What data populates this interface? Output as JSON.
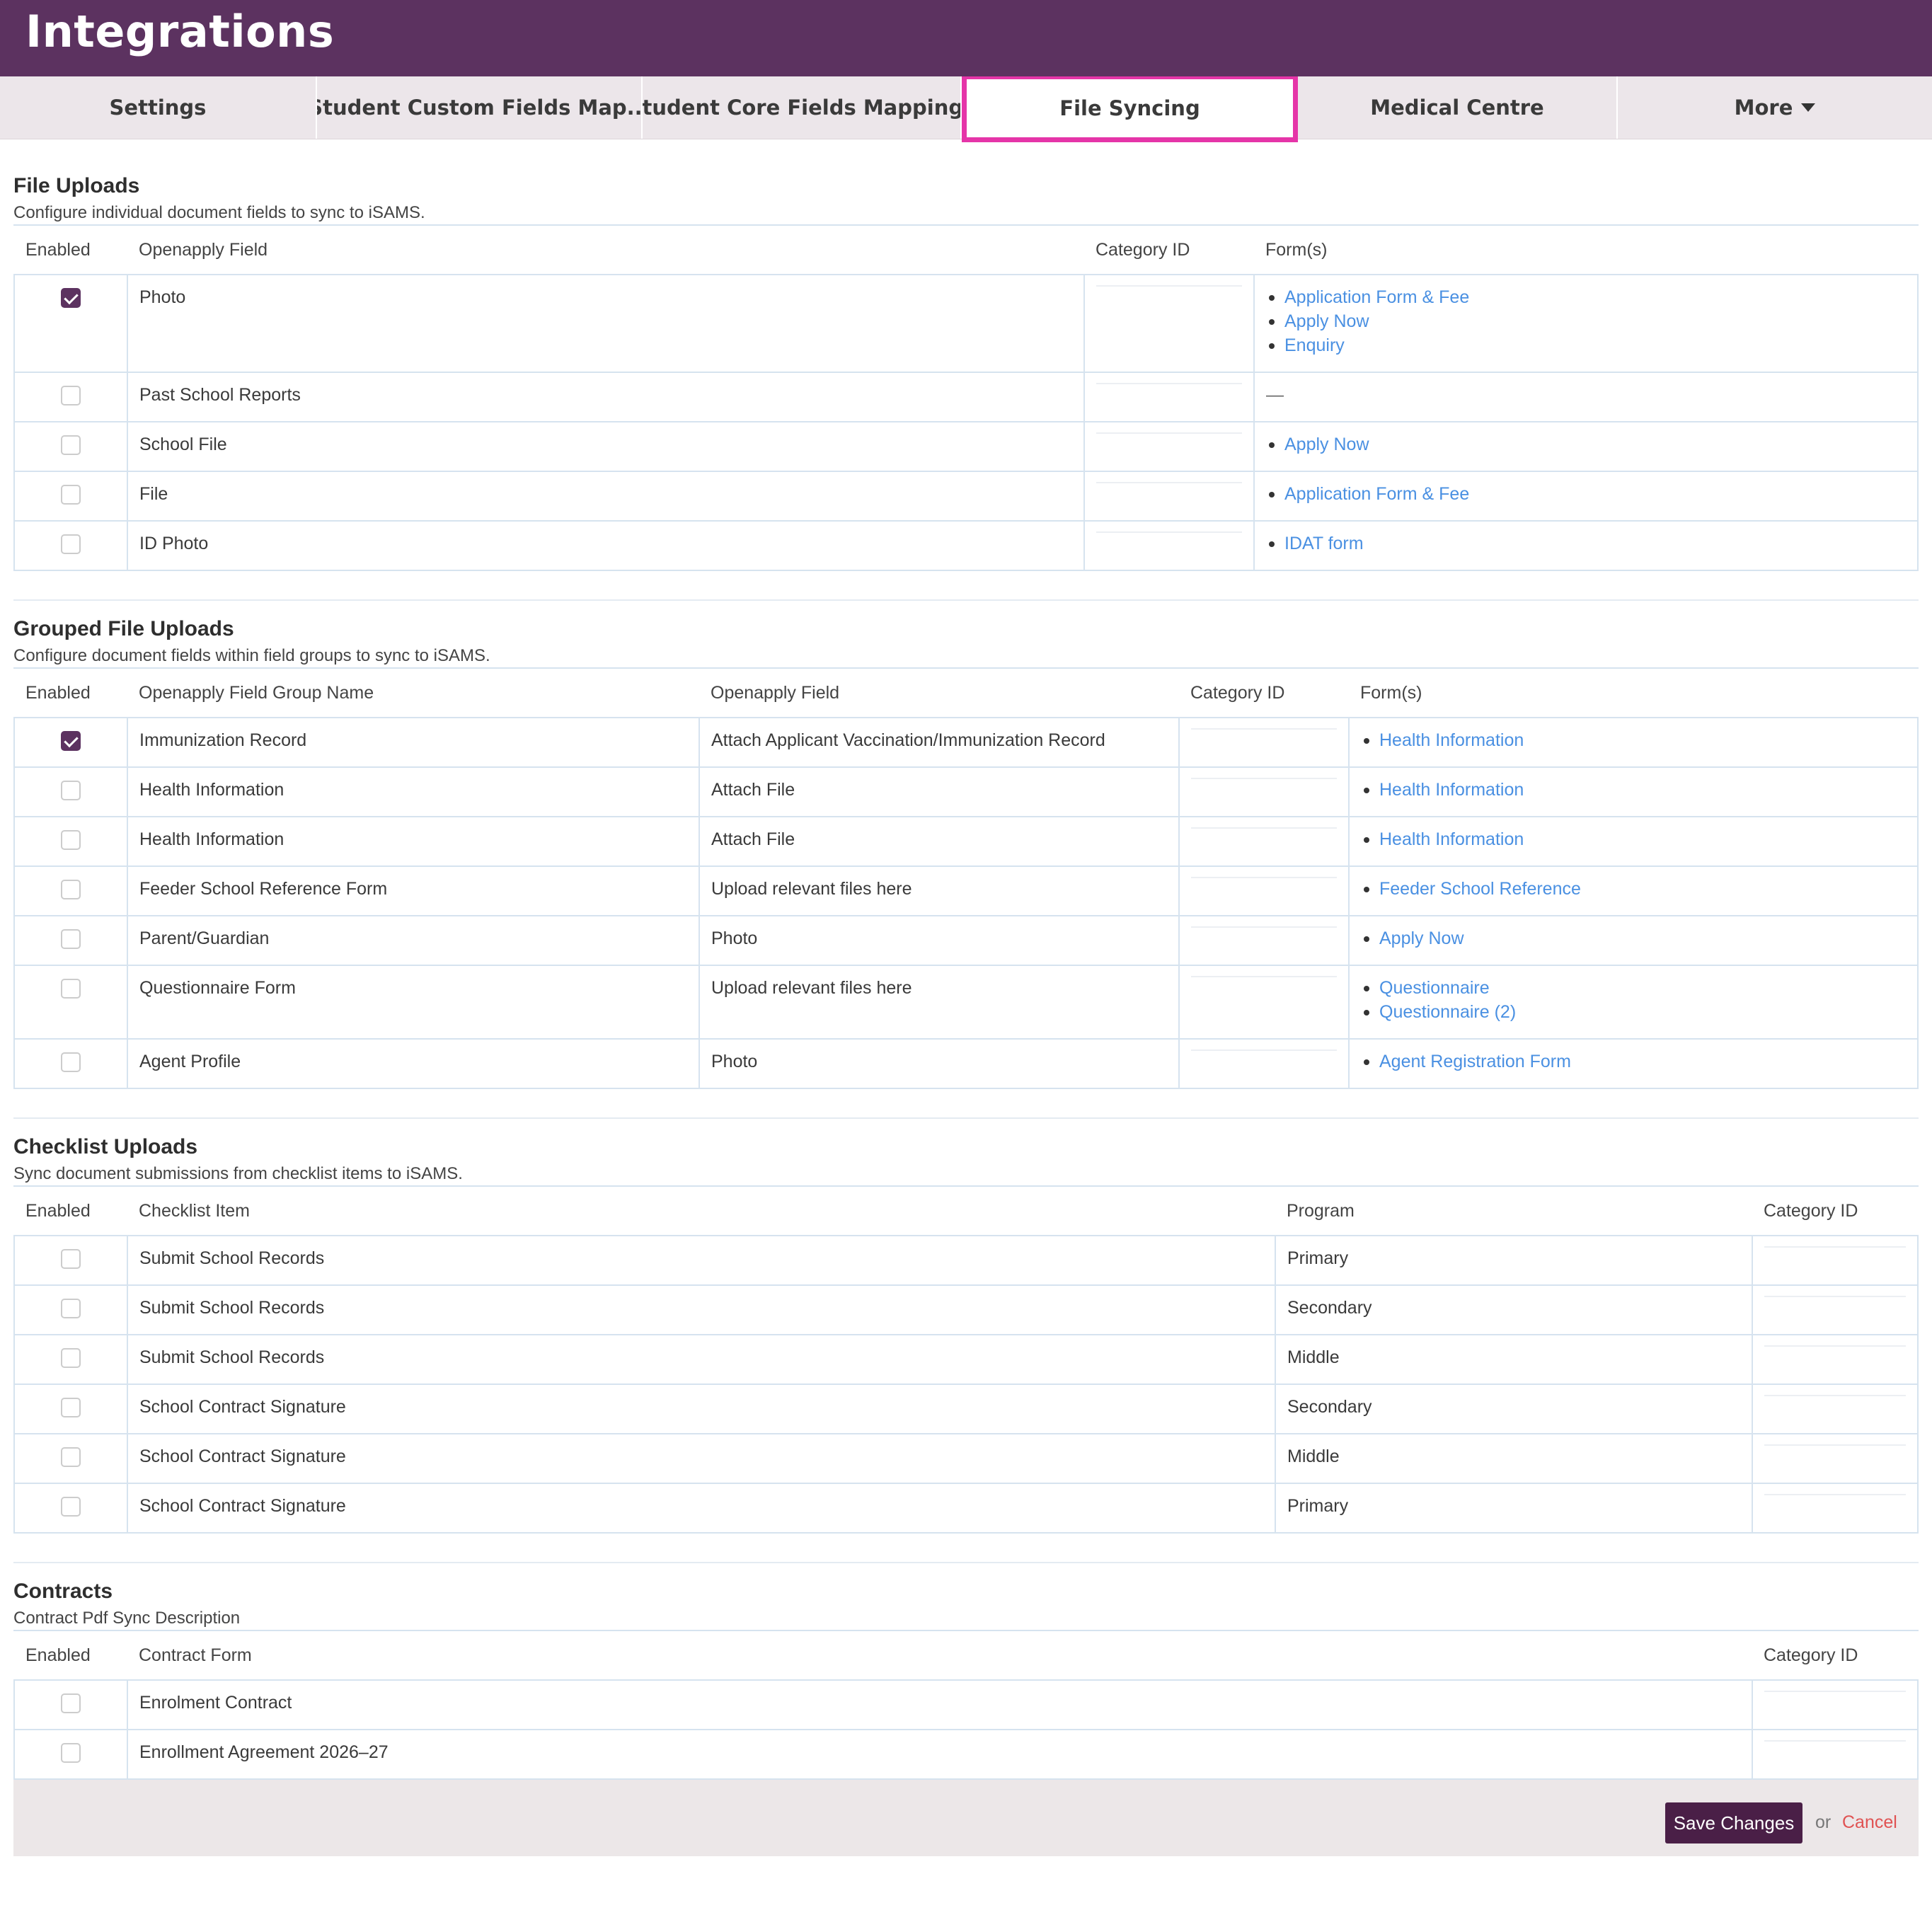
{
  "header": {
    "title": "Integrations"
  },
  "tabs": [
    {
      "label": "Settings"
    },
    {
      "label": "Student Custom Fields Map..."
    },
    {
      "label": "Student Core Fields Mappings"
    },
    {
      "label": "File Syncing"
    },
    {
      "label": "Medical Centre"
    },
    {
      "label": "More"
    }
  ],
  "colors": {
    "brand": "#5c3260",
    "highlight": "#e535a8",
    "link": "#4a90e2",
    "cancel": "#e05252"
  },
  "file_uploads": {
    "title": "File Uploads",
    "description": "Configure individual document fields to sync to iSAMS.",
    "columns": [
      "Enabled",
      "Openapply Field",
      "Category ID",
      "Form(s)"
    ],
    "rows": [
      {
        "enabled": true,
        "field": "Photo",
        "forms": [
          "Application Form & Fee",
          "Apply Now",
          "Enquiry"
        ]
      },
      {
        "enabled": false,
        "field": "Past School Reports",
        "forms": [],
        "empty": "—"
      },
      {
        "enabled": false,
        "field": "School File",
        "forms": [
          "Apply Now"
        ]
      },
      {
        "enabled": false,
        "field": "File",
        "forms": [
          "Application Form & Fee"
        ]
      },
      {
        "enabled": false,
        "field": "ID Photo",
        "forms": [
          "IDAT form"
        ]
      }
    ]
  },
  "grouped_uploads": {
    "title": "Grouped File Uploads",
    "description": "Configure document fields within field groups to sync to iSAMS.",
    "columns": [
      "Enabled",
      "Openapply Field Group Name",
      "Openapply Field",
      "Category ID",
      "Form(s)"
    ],
    "rows": [
      {
        "enabled": true,
        "group": "Immunization Record",
        "field": "Attach Applicant Vaccination/Immunization Record",
        "forms": [
          "Health Information"
        ]
      },
      {
        "enabled": false,
        "group": "Health Information",
        "field": "Attach File",
        "forms": [
          "Health Information"
        ]
      },
      {
        "enabled": false,
        "group": "Health Information",
        "field": "Attach File",
        "forms": [
          "Health Information"
        ]
      },
      {
        "enabled": false,
        "group": "Feeder School Reference Form",
        "field": "Upload relevant files here",
        "forms": [
          "Feeder School Reference"
        ]
      },
      {
        "enabled": false,
        "group": "Parent/Guardian",
        "field": "Photo",
        "forms": [
          "Apply Now"
        ]
      },
      {
        "enabled": false,
        "group": "Questionnaire Form",
        "field": "Upload relevant files here",
        "forms": [
          "Questionnaire",
          "Questionnaire (2)"
        ]
      },
      {
        "enabled": false,
        "group": "Agent Profile",
        "field": "Photo",
        "forms": [
          "Agent Registration Form"
        ]
      }
    ]
  },
  "checklist_uploads": {
    "title": "Checklist Uploads",
    "description": "Sync document submissions from checklist items to iSAMS.",
    "columns": [
      "Enabled",
      "Checklist Item",
      "Program",
      "Category ID"
    ],
    "rows": [
      {
        "enabled": false,
        "item": "Submit School Records",
        "program": "Primary"
      },
      {
        "enabled": false,
        "item": "Submit School Records",
        "program": "Secondary"
      },
      {
        "enabled": false,
        "item": "Submit School Records",
        "program": "Middle"
      },
      {
        "enabled": false,
        "item": "School Contract Signature",
        "program": "Secondary"
      },
      {
        "enabled": false,
        "item": "School Contract Signature",
        "program": "Middle"
      },
      {
        "enabled": false,
        "item": "School Contract Signature",
        "program": "Primary"
      }
    ]
  },
  "contracts": {
    "title": "Contracts",
    "description": "Contract Pdf Sync Description",
    "columns": [
      "Enabled",
      "Contract Form",
      "Category ID"
    ],
    "rows": [
      {
        "enabled": false,
        "form": "Enrolment Contract"
      },
      {
        "enabled": false,
        "form": "Enrollment Agreement 2026–27"
      }
    ]
  },
  "footer": {
    "save_label": "Save Changes",
    "or_label": "or",
    "cancel_label": "Cancel"
  }
}
